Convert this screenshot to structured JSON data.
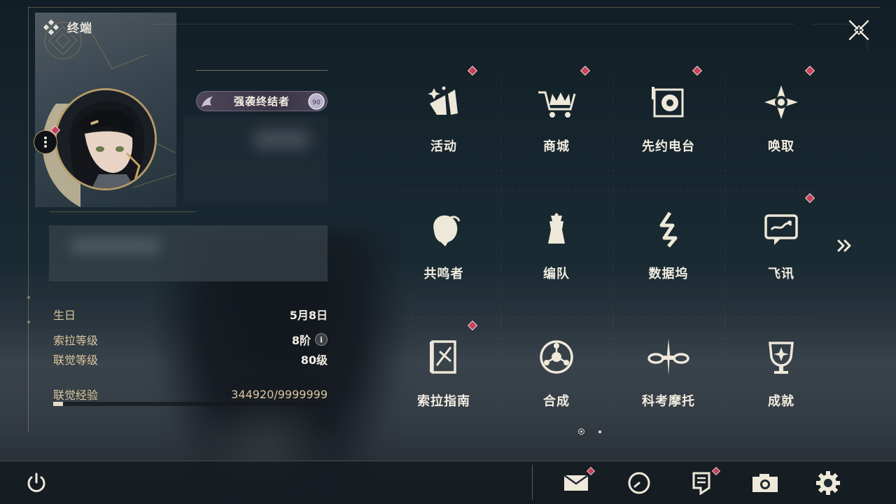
{
  "header": {
    "title": "终端"
  },
  "profile": {
    "title_badge": "强袭终结者",
    "badge_level": "90"
  },
  "stats": {
    "birthday": {
      "label": "生日",
      "value": "5月8日"
    },
    "sola_level": {
      "label": "索拉等级",
      "value": "8阶",
      "info_icon": "i"
    },
    "union_level": {
      "label": "联觉等级",
      "value": "80级"
    },
    "union_exp": {
      "label": "联觉经验",
      "value": "344920/9999999",
      "current": 344920,
      "max": 9999999
    }
  },
  "menu": {
    "items": [
      {
        "label": "活动",
        "icon": "event-icon",
        "badge": true
      },
      {
        "label": "商城",
        "icon": "shop-icon",
        "badge": true
      },
      {
        "label": "先约电台",
        "icon": "radio-icon",
        "badge": true
      },
      {
        "label": "唤取",
        "icon": "convene-icon",
        "badge": true
      },
      {
        "label": "共鸣者",
        "icon": "resonator-icon",
        "badge": false
      },
      {
        "label": "编队",
        "icon": "team-icon",
        "badge": false
      },
      {
        "label": "数据坞",
        "icon": "data-bank-icon",
        "badge": false
      },
      {
        "label": "飞讯",
        "icon": "message-icon",
        "badge": true
      },
      {
        "label": "索拉指南",
        "icon": "guidebook-icon",
        "badge": true
      },
      {
        "label": "合成",
        "icon": "synthesis-icon",
        "badge": false
      },
      {
        "label": "科考摩托",
        "icon": "motorbike-icon",
        "badge": false
      },
      {
        "label": "成就",
        "icon": "achievement-icon",
        "badge": false
      }
    ],
    "page_current": 1,
    "page_total": 2
  },
  "bottom": {
    "buttons": [
      {
        "icon": "mail-icon",
        "badge": true
      },
      {
        "icon": "clock-icon",
        "badge": false
      },
      {
        "icon": "notice-icon",
        "badge": true
      },
      {
        "icon": "camera-icon",
        "badge": false
      },
      {
        "icon": "settings-icon",
        "badge": false
      }
    ]
  },
  "colors": {
    "accent_gold": "#d9c79e",
    "badge_red": "#c2435a",
    "text_light": "#f1ece0"
  }
}
